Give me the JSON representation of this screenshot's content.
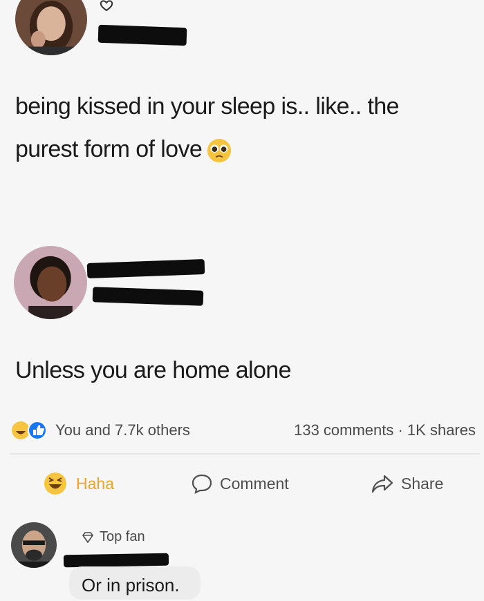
{
  "post": {
    "text_line1": "being kissed in your sleep is.. like.. the",
    "text_line2": "purest form of love",
    "emoji_icon": "pleading-face-icon"
  },
  "reply": {
    "text": "Unless you are home alone"
  },
  "reactions": {
    "icons": [
      "haha-icon",
      "like-icon"
    ],
    "summary": "You and 7.7k others",
    "comments_shares": "133 comments · 1K shares"
  },
  "actions": {
    "haha_label": "Haha",
    "comment_label": "Comment",
    "share_label": "Share"
  },
  "comment": {
    "badge": "Top fan",
    "text": "Or in prison."
  },
  "colors": {
    "haha_accent": "#e9a728",
    "like_blue": "#1877f2",
    "background": "#f6f6f6"
  }
}
